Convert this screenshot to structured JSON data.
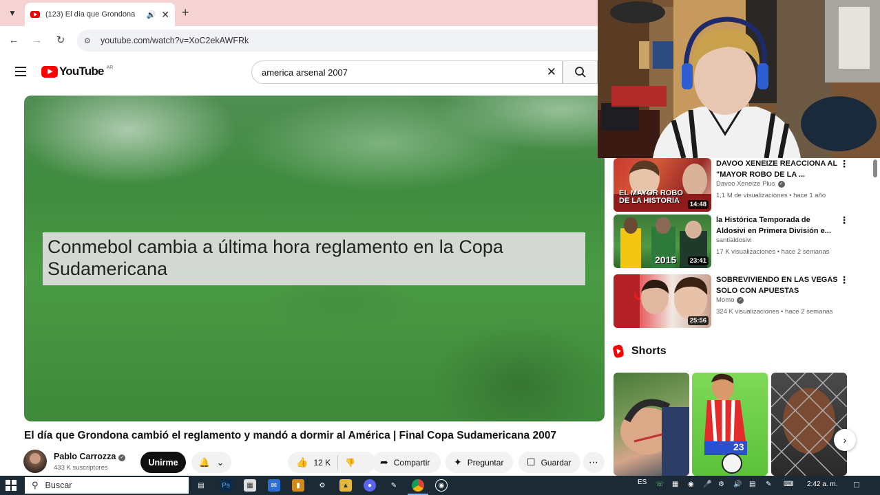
{
  "browser": {
    "tab_title": "(123) El día que Grondona",
    "url": "youtube.com/watch?v=XoC2ekAWFRk"
  },
  "youtube": {
    "logo_text": "YouTube",
    "country_code": "AR",
    "search_query": "america arsenal 2007"
  },
  "player": {
    "caption": "Conmebol cambia a última hora reglamento en la Copa Sudamericana"
  },
  "video": {
    "title": "El día que Grondona cambió el reglamento y mandó a dormir al América | Final Copa Sudamericana 2007",
    "channel_name": "Pablo Carrozza",
    "subscribers": "433 K suscriptores",
    "join_label": "Unirme",
    "likes": "12 K",
    "share_label": "Compartir",
    "ask_label": "Preguntar",
    "save_label": "Guardar"
  },
  "recommendations": [
    {
      "title": "DAVOO XENEIZE REACCIONA AL \"MAYOR ROBO DE LA ...",
      "channel": "Davoo Xeneize Plus",
      "verified": true,
      "meta": "1,1 M de visualizaciones • hace 1 año",
      "duration": "14:48",
      "thumb_text": "EL MAYOR ROBO DE LA HISTORIA",
      "accent": "#d2342a"
    },
    {
      "title": "la Histórica Temporada de Aldosivi en Primera División e...",
      "channel": "santialdosivi",
      "verified": false,
      "meta": "17 K visualizaciones • hace 2 semanas",
      "duration": "23:41",
      "thumb_text": "2015",
      "accent": "#f2c511"
    },
    {
      "title": "SOBREVIVIENDO EN LAS VEGAS SOLO CON APUESTAS",
      "channel": "Momo",
      "verified": true,
      "meta": "324 K visualizaciones • hace 2 semanas",
      "duration": "25:56",
      "thumb_text": "",
      "accent": "#c8262a"
    }
  ],
  "shorts": {
    "heading": "Shorts",
    "second_short_number": "23"
  },
  "taskbar": {
    "search_placeholder": "Buscar",
    "language": "ES",
    "time": "2:42 a. m."
  },
  "colors": {
    "youtube_red": "#ff0000",
    "tab_strip": "#f6d3d3",
    "taskbar": "#1c2a35"
  }
}
